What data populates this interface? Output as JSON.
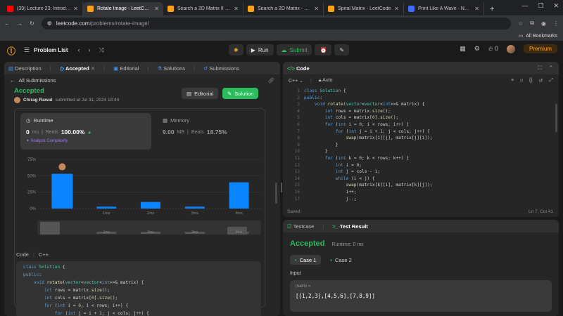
{
  "browser": {
    "tabs": [
      {
        "title": "(39) Lecture 23: Introductio",
        "color": "#ff0000",
        "active": false
      },
      {
        "title": "Rotate Image - LeetCode",
        "color": "#ffa116",
        "active": true
      },
      {
        "title": "Search a 2D Matrix II - Lee",
        "color": "#ffa116",
        "active": false
      },
      {
        "title": "Search a 2D Matrix - LeetC",
        "color": "#ffa116",
        "active": false
      },
      {
        "title": "Spiral Matrix - LeetCode",
        "color": "#ffa116",
        "active": false
      },
      {
        "title": "Print Like A Wave - Naukri",
        "color": "#3e6bf7",
        "active": false
      }
    ],
    "url_domain": "leetcode.com",
    "url_path": "/problems/rotate-image/",
    "bookmarks_label": "All Bookmarks"
  },
  "nav": {
    "problem_list": "Problem List",
    "run": "Run",
    "submit": "Submit",
    "streak": "0",
    "premium": "Premium"
  },
  "left": {
    "tabs": {
      "description": "Description",
      "accepted": "Accepted",
      "editorial": "Editorial",
      "solutions": "Solutions",
      "submissions": "Submissions"
    },
    "back": "All Submissions",
    "status": "Accepted",
    "author": "Chirag Rawat",
    "submitted_text": "submitted at Jul 31, 2024 18:44",
    "editorial_btn": "Editorial",
    "solution_btn": "Solution",
    "runtime": {
      "label": "Runtime",
      "value": "0",
      "unit": "ms",
      "beats_label": "Beats",
      "beats": "100.00%"
    },
    "memory": {
      "label": "Memory",
      "value": "9.00",
      "unit": "MB",
      "beats_label": "Beats",
      "beats": "18.75%"
    },
    "analyze": "Analyze Complexity",
    "code_label": "Code",
    "lang": "C++"
  },
  "chart_data": {
    "type": "bar",
    "categories": [
      "",
      "1ms",
      "2ms",
      "3ms",
      "4ms"
    ],
    "values": [
      53,
      3,
      10,
      3,
      40
    ],
    "ylim": [
      0,
      75
    ],
    "yticks": [
      "0%",
      "25%",
      "50%",
      "75%"
    ],
    "highlight_index": 0,
    "mini_labels": [
      "1ms",
      "2ms",
      "3ms",
      "4ms"
    ]
  },
  "editor": {
    "title": "Code",
    "lang": "C++",
    "mode": "Auto",
    "saved": "Saved",
    "cursor": "Ln 7, Col 41"
  },
  "code_lines": [
    "class Solution {",
    "public:",
    "    void rotate(vector<vector<int>>& matrix) {",
    "        int rows = matrix.size();",
    "        int cols = matrix[0].size();",
    "        for (int i = 0; i < rows; i++) {",
    "            for (int j = i + 1; j < cols; j++) {",
    "                swap(matrix[i][j], matrix[j][i]);",
    "            }",
    "        }",
    "        for (int k = 0; k < rows; k++) {",
    "            int i = 0;",
    "            int j = cols - 1;",
    "            while (i < j) {",
    "                swap(matrix[k][i], matrix[k][j]);",
    "                i++;",
    "                j--;"
  ],
  "left_code_lines": [
    "class Solution {",
    "public:",
    "    void rotate(vector<vector<int>>& matrix) {",
    "        int rows = matrix.size();",
    "        int cols = matrix[0].size();",
    "        for (int i = 0; i < rows; i++) {",
    "            for (int j = i + 1; j < cols; j++) {"
  ],
  "test": {
    "testcase_tab": "Testcase",
    "result_tab": "Test Result",
    "status": "Accepted",
    "runtime": "Runtime: 0 ms",
    "case1": "Case 1",
    "case2": "Case 2",
    "input_label": "Input",
    "var": "matrix =",
    "value": "[[1,2,3],[4,5,6],[7,8,9]]"
  }
}
